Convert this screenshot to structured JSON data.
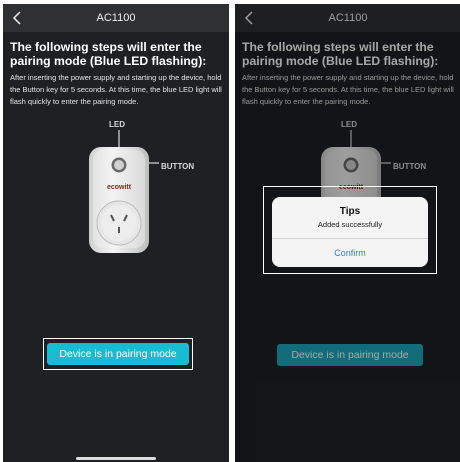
{
  "left_screen": {
    "nav": {
      "title": "AC1100",
      "back_icon": "chevron-left-icon"
    },
    "heading": "The following steps will enter the pairing mode (Blue LED flashing):",
    "description": "After inserting the power supply and starting up the device, hold the Button key for 5 seconds. At this time, the blue LED light will flash quickly to enter the pairing mode.",
    "device": {
      "led_label": "LED",
      "button_label": "BUTTON",
      "brand": "ecowitt"
    },
    "primary_button": "Device is in pairing mode"
  },
  "right_screen": {
    "nav": {
      "title": "AC1100",
      "back_icon": "chevron-left-icon"
    },
    "heading": "The following steps will enter the pairing mode (Blue LED flashing):",
    "description": "After inserting the power supply and starting up the device, hold the Button key for 5 seconds. At this time, the blue LED light will flash quickly to enter the pairing mode.",
    "device": {
      "led_label": "LED",
      "button_label": "BUTTON",
      "brand": "ecowitt"
    },
    "primary_button": "Device is in pairing mode",
    "dialog": {
      "title": "Tips",
      "message": "Added successfully",
      "confirm_label": "Confirm"
    }
  },
  "colors": {
    "screen_bg": "#1e2024",
    "navbar_bg": "#2e3034",
    "accent": "#18bcd0",
    "dialog_link": "#2f7fe0"
  }
}
